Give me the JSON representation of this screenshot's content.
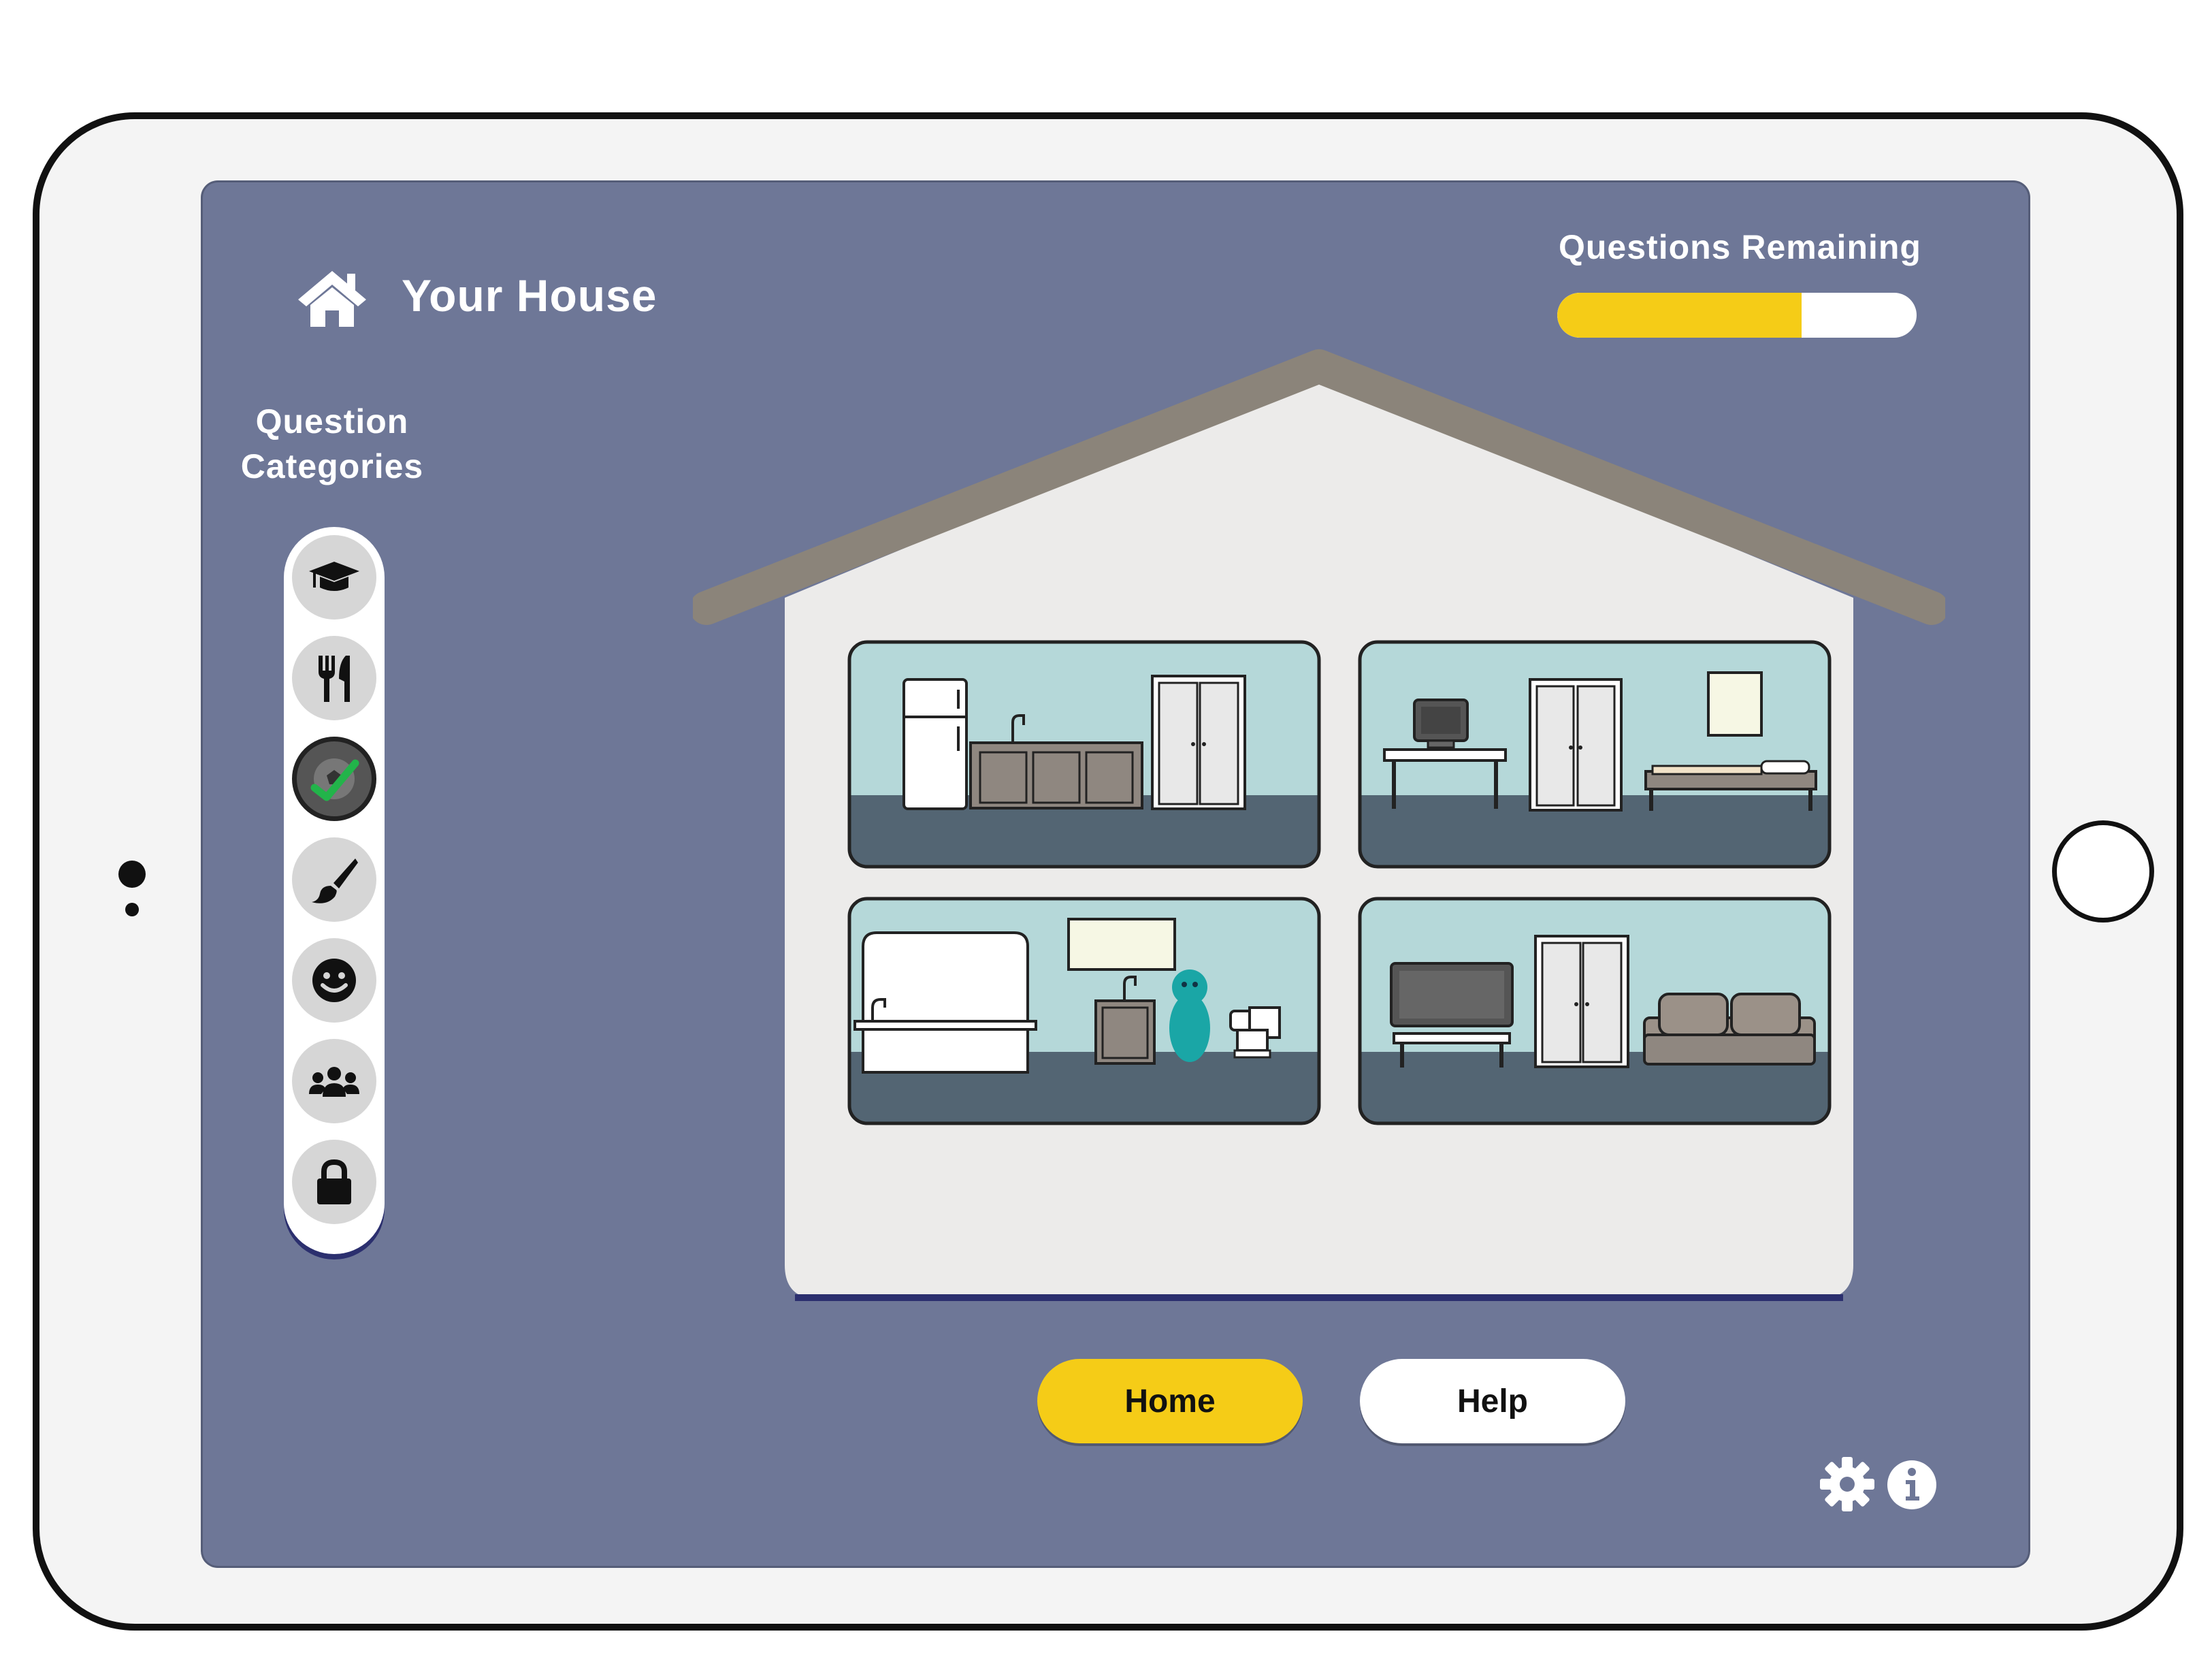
{
  "header": {
    "title": "Your House",
    "icon": "house-icon"
  },
  "progress": {
    "label": "Questions Remaining",
    "fraction": 0.68,
    "color": "#f5cc17"
  },
  "categories": {
    "title_line1": "Question",
    "title_line2": "Categories",
    "items": [
      {
        "icon": "graduation-cap-icon",
        "state": "default"
      },
      {
        "icon": "fork-knife-icon",
        "state": "default"
      },
      {
        "icon": "soccer-ball-icon",
        "state": "completed"
      },
      {
        "icon": "paintbrush-icon",
        "state": "default"
      },
      {
        "icon": "smiley-face-icon",
        "state": "default"
      },
      {
        "icon": "group-people-icon",
        "state": "default"
      },
      {
        "icon": "lock-icon",
        "state": "locked"
      }
    ]
  },
  "rooms": [
    "kitchen",
    "bedroom",
    "bathroom",
    "living-room"
  ],
  "buttons": {
    "home": "Home",
    "help": "Help"
  },
  "footer_icons": [
    "gear-icon",
    "info-icon"
  ],
  "colors": {
    "screen": "#6e7797",
    "accent": "#f5cc17",
    "check": "#22b44a",
    "roof": "#8b847a",
    "room_wall": "#b5d8d9",
    "room_floor": "#536573"
  }
}
